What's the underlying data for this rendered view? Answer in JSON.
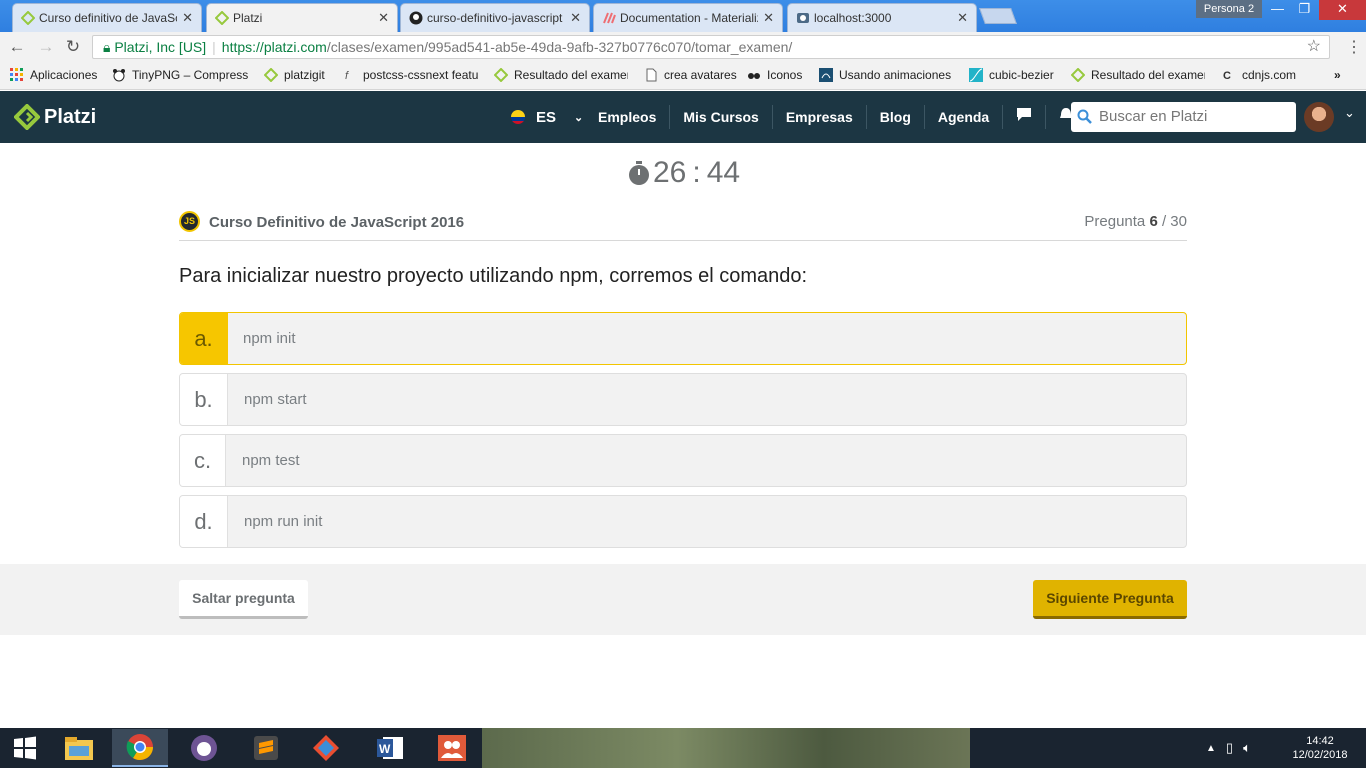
{
  "browser": {
    "tabs": [
      {
        "title": "Curso definitivo de JavaScript",
        "icon": "platzi-favicon"
      },
      {
        "title": "Platzi",
        "icon": "platzi-favicon",
        "active": true
      },
      {
        "title": "curso-definitivo-javascript",
        "icon": "github-favicon"
      },
      {
        "title": "Documentation - Materialize",
        "icon": "materialize-favicon"
      },
      {
        "title": "localhost:3000",
        "icon": "page-favicon"
      }
    ],
    "profile": "Persona 2",
    "address": {
      "secure_label": "Platzi, Inc [US]",
      "url_host": "https://platzi.com",
      "url_path": "/clases/examen/995ad541-ab5e-49da-9afb-327b0776c070/tomar_examen/"
    },
    "bookmarks": [
      {
        "label": "Aplicaciones",
        "icon": "apps-grid-icon"
      },
      {
        "label": "TinyPNG – Compress",
        "icon": "panda-icon"
      },
      {
        "label": "platzigit",
        "icon": "platzi-icon"
      },
      {
        "label": "postcss-cssnext featu",
        "icon": "postcss-icon"
      },
      {
        "label": "Resultado del examen",
        "icon": "platzi-icon"
      },
      {
        "label": "crea avatares",
        "icon": "page-icon"
      },
      {
        "label": "Iconos",
        "icon": "glasses-icon"
      },
      {
        "label": "Usando animaciones",
        "icon": "animation-icon"
      },
      {
        "label": "cubic-bezier",
        "icon": "bezier-icon"
      },
      {
        "label": "Resultado del examen",
        "icon": "platzi-icon"
      },
      {
        "label": "cdnjs.com",
        "icon": "cdnjs-icon"
      }
    ]
  },
  "header": {
    "logo": "Platzi",
    "language": "ES",
    "nav": [
      "Empleos",
      "Mis Cursos",
      "Empresas",
      "Blog",
      "Agenda"
    ],
    "search_placeholder": "Buscar en Platzi"
  },
  "exam": {
    "timer_minutes": "26",
    "timer_sep": ":",
    "timer_seconds": "44",
    "course_badge": "JS",
    "course_title": "Curso Definitivo de JavaScript 2016",
    "question_label": "Pregunta",
    "question_current": "6",
    "question_total": "/ 30",
    "question": "Para inicializar nuestro proyecto utilizando npm, corremos el comando:",
    "options": [
      {
        "letter": "a.",
        "text": "npm init",
        "selected": true
      },
      {
        "letter": "b.",
        "text": "npm start",
        "selected": false
      },
      {
        "letter": "c.",
        "text": "npm test",
        "selected": false
      },
      {
        "letter": "d.",
        "text": "npm run init",
        "selected": false
      }
    ],
    "skip_label": "Saltar pregunta",
    "next_label": "Siguiente Pregunta"
  },
  "taskbar": {
    "apps": [
      "file-explorer-icon",
      "chrome-icon",
      "github-desktop-icon",
      "sublime-text-icon",
      "git-icon",
      "word-icon",
      "people-icon"
    ],
    "time": "14:42",
    "date": "12/02/2018"
  },
  "colors": {
    "header_bg": "#1c3643",
    "accent_yellow": "#f6c600",
    "next_button": "#e0b300"
  }
}
